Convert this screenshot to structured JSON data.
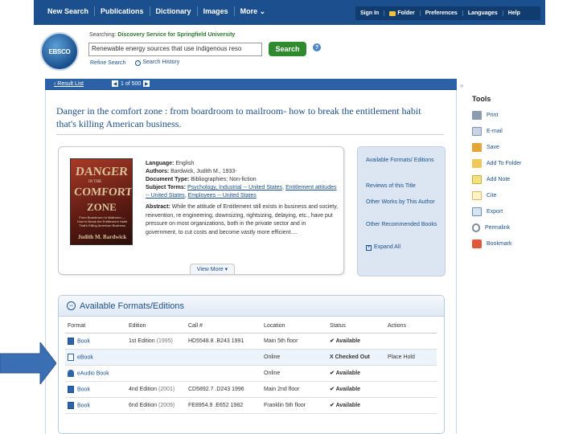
{
  "topnav": {
    "left": [
      "New Search",
      "Publications",
      "Dictionary",
      "Images",
      "More ⌄"
    ],
    "right": [
      "Sign In",
      "Folder",
      "Preferences",
      "Languages",
      "Help"
    ]
  },
  "logo": {
    "text": "EBSCO"
  },
  "search": {
    "searching_label": "Searching:",
    "searching_target": "Discovery Service for Springfield University",
    "query": "Renewable energy sources that use indigenous reso",
    "button": "Search",
    "help": "?",
    "refine": "Refine Search",
    "history": "Search History"
  },
  "resultbar": {
    "back_link": "‹ Result List",
    "counter": "1 of 500"
  },
  "record": {
    "title": "Danger in the comfort zone : from boardroom to mailroom- how to break the entitlement habit that's killing American business.",
    "cover": {
      "line1": "DANGER",
      "line2": "IN THE",
      "line3": "COMFORT",
      "line4": "ZONE",
      "tagline": "From Boardroom to Mailroom — How to Break the Entitlement Habit That's Killing American Business",
      "author": "Judith M. Bardwick"
    },
    "language_label": "Language:",
    "language": "English",
    "authors_label": "Authors:",
    "authors": "Bardwick, Judith M., 1933-",
    "doctype_label": "Document Type:",
    "doctype": "Bibliographies; Non-fiction",
    "subjects_label": "Subject Terms:",
    "subject1": "Psychology, Industrial -- United States",
    "subject2": "Entitlement attitudes -- United States",
    "subject3": "Employees -- United States",
    "abstract_label": "Abstract:",
    "abstract": "While the attitude of Entitlement still exists in business and society, reinvention, re engineering, downsizing, rightsizing, delaying, etc., have put pressure on most organizations, both in the private sector and in government, to cut costs and become vastly more efficient....",
    "view_more": "View More ▾"
  },
  "rightlinks": {
    "formats": "Available Formats/ Editions",
    "reviews": "Reviews of this Title",
    "other_works": "Other Works by This Author",
    "recommended": "Other Recommended Books",
    "expand": "Expand All"
  },
  "formats": {
    "title": "Available Formats/Editions",
    "headers": [
      "Format",
      "Edition",
      "Call #",
      "Location",
      "Status",
      "Actions"
    ],
    "rows": [
      {
        "format": "Book",
        "edition": "1st Edition",
        "year": "(1995)",
        "call": "HD5548.8 .B243 1991",
        "location": "Main 5th floor",
        "status": "Available",
        "action": ""
      },
      {
        "format": "eBook",
        "edition": "",
        "year": "",
        "call": "",
        "location": "Online",
        "status": "Checked Out",
        "action": "Place Hold"
      },
      {
        "format": "eAudio Book",
        "edition": "",
        "year": "",
        "call": "",
        "location": "Online",
        "status": "Available",
        "action": ""
      },
      {
        "format": "Book",
        "edition": "4nd Edition",
        "year": "(2001)",
        "call": "CD5892.7 .D243 1996",
        "location": "Main 2nd floor",
        "status": "Available",
        "action": ""
      },
      {
        "format": "Book",
        "edition": "6nd Edition",
        "year": "(2009)",
        "call": "FE8954.9 .E652 1982",
        "location": "Franklin 5th floor",
        "status": "Available",
        "action": ""
      }
    ]
  },
  "tools": {
    "title": "Tools",
    "items": [
      "Print",
      "E-mail",
      "Save",
      "Add To Folder",
      "Add Note",
      "Cite",
      "Export",
      "Permalink",
      "Bookmark"
    ]
  }
}
